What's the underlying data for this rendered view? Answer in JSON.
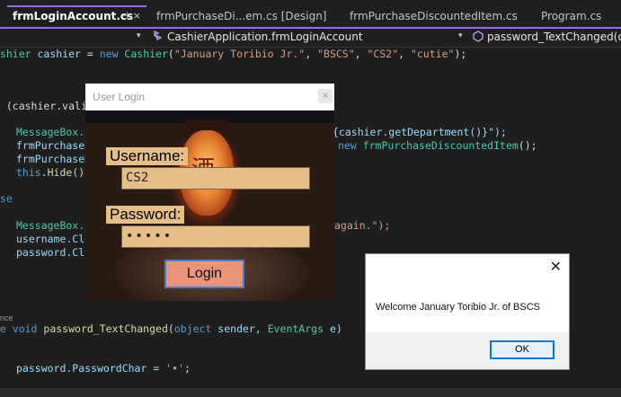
{
  "tabs": [
    {
      "label": "frmLoginAccount.cs",
      "active": true,
      "pin": "⊣",
      "close": "×"
    },
    {
      "label": "frmPurchaseDi...em.cs [Design]",
      "active": false
    },
    {
      "label": "frmPurchaseDiscountedItem.cs",
      "active": false
    },
    {
      "label": "Program.cs",
      "active": false
    }
  ],
  "navbar": {
    "left_dropdown": "▾",
    "class_icon": "class-icon",
    "class_path": "CashierApplication.frmLoginAccount",
    "member_dropdown": "▾",
    "member_icon": "method-icon",
    "member": "password_TextChanged(obje"
  },
  "code": {
    "l1": {
      "a": "ashier ",
      "b": "cashier",
      "c": " = ",
      "d": "new ",
      "e": "Cashier",
      "f": "(",
      "g": "\"January Toribio Jr.\"",
      "h": ", ",
      "i": "\"BSCS\"",
      "j": ", ",
      "k": "\"CS2\"",
      "l": ", ",
      "m": "\"cutie\"",
      "n": ");"
    },
    "l2": {
      "a": "f ",
      "b": "(cashier.vali"
    },
    "l3": {
      "a": "MessageBox.S",
      "b": "{cashier.getDepartment()}\");"
    },
    "l4": {
      "a": "frmPurchaseD",
      "b": "new ",
      "c": "frmPurchaseDiscountedItem",
      "d": "();"
    },
    "l5": {
      "a": "frmPurchaseD"
    },
    "l6": {
      "a": "this",
      "b": ".Hide();"
    },
    "l7": {
      "a": "lse"
    },
    "l8": {
      "a": "MessageBox.S",
      "b": "again.\");"
    },
    "l9": {
      "a": "username.Cle"
    },
    "l10": {
      "a": "password.Clo"
    },
    "ref": "nce",
    "l11": {
      "a": "te ",
      "b": "void ",
      "c": "password_TextChanged",
      "d": "(",
      "e": "object ",
      "f": "sender, ",
      "g": "EventArgs ",
      "h": "e)"
    },
    "l12": {
      "a": "password.PasswordChar = ",
      "b": "'•'",
      "c": ";"
    }
  },
  "login": {
    "title": "User Login",
    "close": "×",
    "lantern_text": "酒",
    "username_label": "Username:",
    "username_value": "CS2",
    "password_label": "Password:",
    "password_value": "•••••",
    "button": "Login"
  },
  "message": {
    "close": "✕",
    "text": "Welcome January Toribio Jr. of BSCS",
    "ok": "OK"
  }
}
